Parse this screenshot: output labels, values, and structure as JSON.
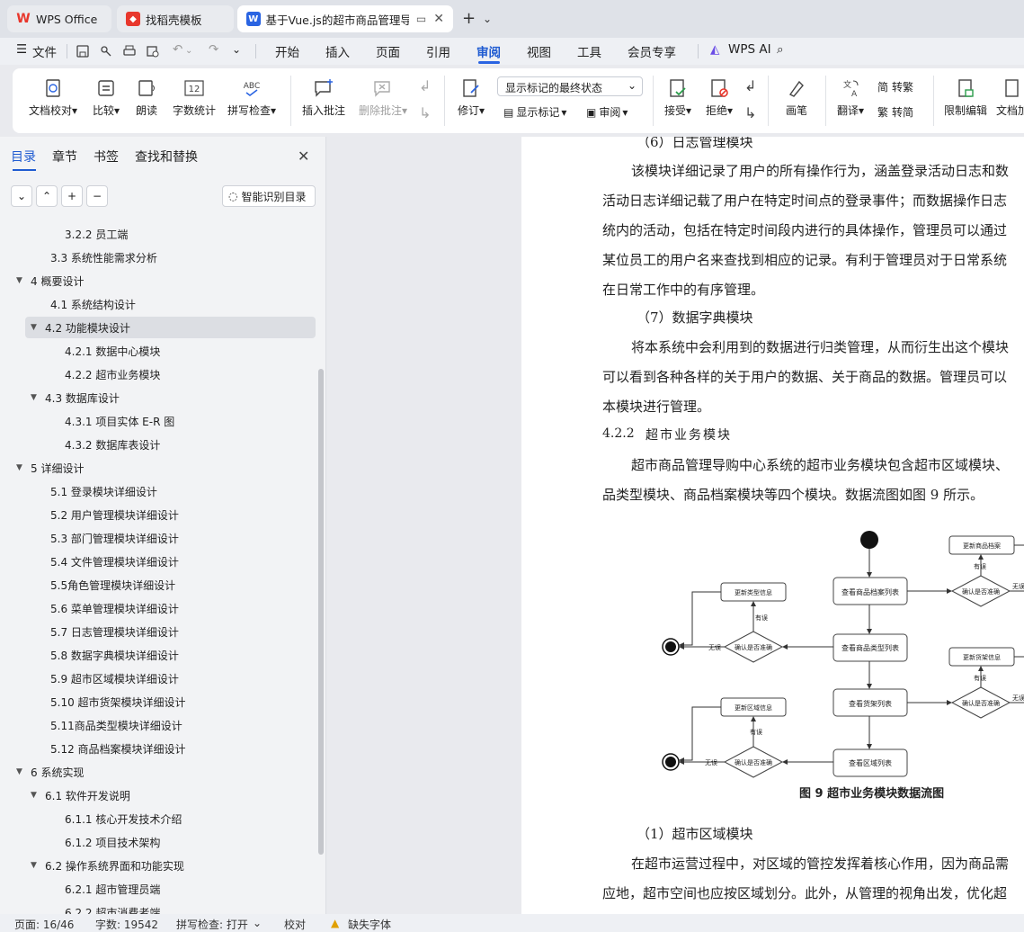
{
  "tabs": [
    {
      "label": "WPS Office",
      "icon": "wps-logo-icon"
    },
    {
      "label": "找稻壳模板",
      "icon": "docer-icon"
    },
    {
      "label": "基于Vue.js的超市商品管理导购",
      "icon": "writer-icon"
    }
  ],
  "menu": {
    "file": "文件",
    "items": [
      "开始",
      "插入",
      "页面",
      "引用",
      "审阅",
      "视图",
      "工具",
      "会员专享"
    ],
    "active": "审阅",
    "wps_ai": "WPS AI"
  },
  "ribbon": {
    "doc_proof": "文档校对",
    "compare": "比较",
    "read_aloud": "朗读",
    "word_count": "字数统计",
    "spell_check": "拼写检查",
    "insert_comment": "插入批注",
    "delete_comment": "删除批注",
    "revise": "修订",
    "markup_mode": "显示标记的最终状态",
    "show_markup": "显示标记",
    "review": "审阅",
    "accept": "接受",
    "reject": "拒绝",
    "pen": "画笔",
    "translate": "翻译",
    "to_traditional": "转繁",
    "to_simplified": "转简",
    "restrict_edit": "限制编辑",
    "doc_more": "文档加",
    "icon_label": "12"
  },
  "left_panel": {
    "tabs": [
      "目录",
      "章节",
      "书签",
      "查找和替换"
    ],
    "active_tab": "目录",
    "smart_toc": "智能识别目录",
    "nav_buttons": [
      "⌄",
      "⌃",
      "+",
      "−"
    ],
    "toc": [
      {
        "label": "3.2.2  员工端",
        "level": 3
      },
      {
        "label": "3.3    系统性能需求分析",
        "level": 2
      },
      {
        "label": "4    概要设计",
        "level": 1,
        "expanded": true
      },
      {
        "label": "4.1    系统结构设计",
        "level": 2
      },
      {
        "label": "4.2    功能模块设计",
        "level": 2,
        "expanded": true,
        "selected": true
      },
      {
        "label": "4.2.1    数据中心模块",
        "level": 3
      },
      {
        "label": "4.2.2    超市业务模块",
        "level": 3
      },
      {
        "label": "4.3    数据库设计",
        "level": 2,
        "expanded": true
      },
      {
        "label": "4.3.1    项目实体 E-R 图",
        "level": 3
      },
      {
        "label": "4.3.2    数据库表设计",
        "level": 3
      },
      {
        "label": "5  详细设计",
        "level": 1,
        "expanded": true
      },
      {
        "label": "5.1  登录模块详细设计",
        "level": 2
      },
      {
        "label": "5.2  用户管理模块详细设计",
        "level": 2
      },
      {
        "label": "5.3  部门管理模块详细设计",
        "level": 2
      },
      {
        "label": "5.4  文件管理模块详细设计",
        "level": 2
      },
      {
        "label": "5.5角色管理模块详细设计",
        "level": 2
      },
      {
        "label": "5.6  菜单管理模块详细设计",
        "level": 2
      },
      {
        "label": "5.7  日志管理模块详细设计",
        "level": 2
      },
      {
        "label": "5.8  数据字典模块详细设计",
        "level": 2
      },
      {
        "label": "5.9  超市区域模块详细设计",
        "level": 2
      },
      {
        "label": "5.10  超市货架模块详细设计",
        "level": 2
      },
      {
        "label": "5.11商品类型模块详细设计",
        "level": 2
      },
      {
        "label": "5.12  商品档案模块详细设计",
        "level": 2
      },
      {
        "label": "6    系统实现",
        "level": 1,
        "expanded": true
      },
      {
        "label": "6.1    软件开发说明",
        "level": 2,
        "expanded": true
      },
      {
        "label": "6.1.1    核心开发技术介绍",
        "level": 3
      },
      {
        "label": "6.1.2    项目技术架构",
        "level": 3
      },
      {
        "label": "6.2    操作系统界面和功能实现",
        "level": 2,
        "expanded": true
      },
      {
        "label": "6.2.1  超市管理员端",
        "level": 3
      },
      {
        "label": "6.2.2  超市消费者端",
        "level": 3
      }
    ]
  },
  "document": {
    "lines": [
      "（6）日志管理模块",
      "该模块详细记录了用户的所有操作行为，涵盖登录活动日志和数",
      "活动日志详细记载了用户在特定时间点的登录事件；而数据操作日志",
      "统内的活动，包括在特定时间段内进行的具体操作，管理员可以通过",
      "某位员工的用户名来查找到相应的记录。有利于管理员对于日常系统",
      "在日常工作中的有序管理。",
      "（7）数据字典模块",
      "将本系统中会利用到的数据进行归类管理，从而衍生出这个模块",
      "可以看到各种各样的关于用户的数据、关于商品的数据。管理员可以",
      "本模块进行管理。",
      "超市商品管理导购中心系统的超市业务模块包含超市区域模块、",
      "品类型模块、商品档案模块等四个模块。数据流图如图 9 所示。",
      "（1）超市区域模块",
      "在超市运营过程中，对区域的管控发挥着核心作用，因为商品需",
      "应地，超市空间也应按区域划分。此外，从管理的视角出发，优化超"
    ],
    "heading_num": "4.2.2",
    "heading_text": "超市业务模块",
    "flow": {
      "update_archive": "更新商品档案",
      "view_archive": "查看商品档案列表",
      "confirm": "确认是否准确",
      "update_type": "更新类型信息",
      "view_type": "查看商品类型列表",
      "update_shelf": "更新货架信息",
      "view_shelf": "查看货架列表",
      "update_area": "更新区域信息",
      "view_area": "查看区域列表",
      "has_error": "有误",
      "no_error": "无误",
      "no_error_cut": "无误"
    },
    "caption": "图 9  超市业务模块数据流图"
  },
  "status": {
    "page": "页面: 16/46",
    "words": "字数: 19542",
    "spell": "拼写检查: 打开",
    "proof": "校对",
    "missing_font": "缺失字体"
  },
  "colors": {
    "accent": "#1f5bd1",
    "wps_red": "#e8372c"
  }
}
